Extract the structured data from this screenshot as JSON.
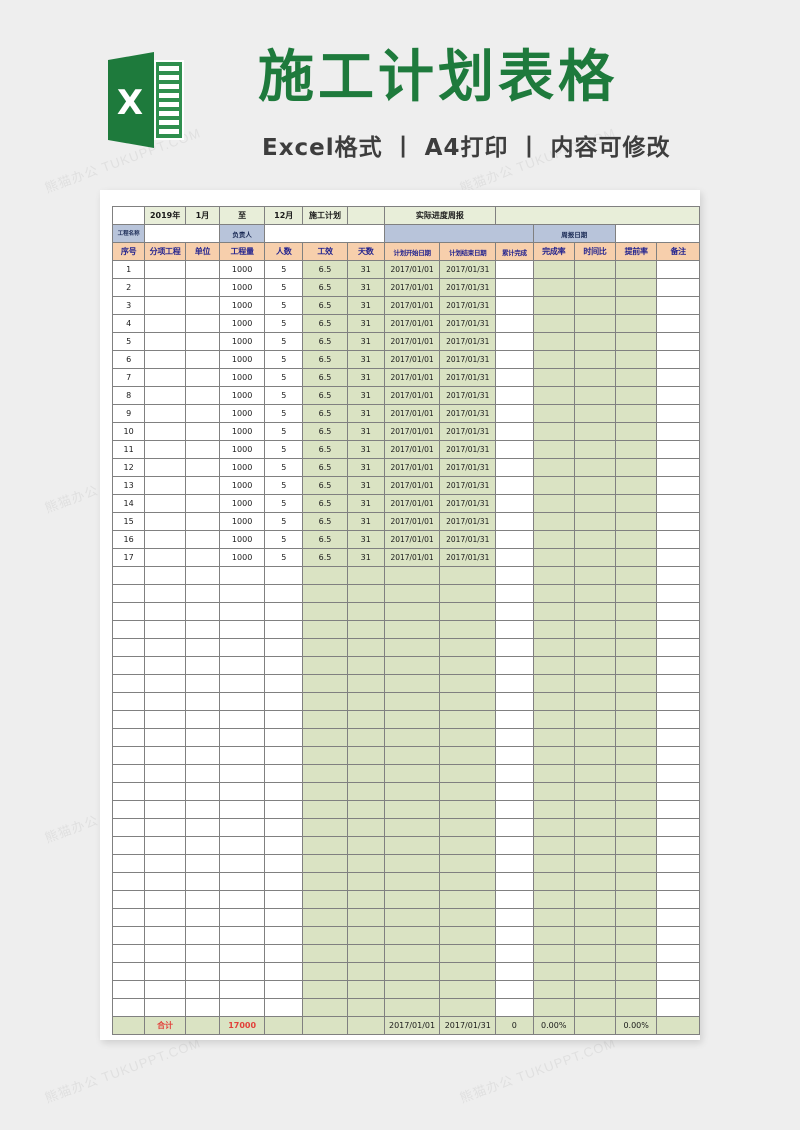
{
  "banner": {
    "title": "施工计划表格",
    "subtitle": "Excel格式 丨 A4打印 丨 内容可修改",
    "logo_letter": "X",
    "brand_color": "#1e7a3c"
  },
  "watermarks": [
    "熊猫办公 TUKUPPT.COM",
    "熊猫办公 TUKUPPT.COM",
    "熊猫办公 TUKUPPT.COM",
    "熊猫办公 TUKUPPT.COM",
    "熊猫办公 TUKUPPT.COM",
    "熊猫办公 TUKUPPT.COM",
    "熊猫办公 TUKUPPT.COM",
    "熊猫办公 TUKUPPT.COM",
    "熊猫办公 TUKUPPT.COM",
    "熊猫办公 TUKUPPT.COM"
  ],
  "sheet": {
    "title_strip": {
      "year": "2019年",
      "start_month": "1月",
      "to": "至",
      "end_month": "12月",
      "plan_label": "施工计划",
      "progress_label": "实际进度周报"
    },
    "group_headers": {
      "project_name": "工程名称",
      "owner": "负责人",
      "weekly_date": "周报日期"
    },
    "columns": [
      "序号",
      "分项工程",
      "单位",
      "工程量",
      "人数",
      "工效",
      "天数",
      "计划开始日期",
      "计划结束日期",
      "累计完成",
      "完成率",
      "时间比",
      "提前率",
      "备注"
    ],
    "rows": [
      {
        "no": "1",
        "sub": "",
        "unit": "",
        "qty": "1000",
        "people": "5",
        "eff": "6.5",
        "days": "31",
        "start": "2017/01/01",
        "end": "2017/01/31",
        "done": "",
        "rate": "",
        "timeratio": "",
        "ahead": "",
        "remark": ""
      },
      {
        "no": "2",
        "sub": "",
        "unit": "",
        "qty": "1000",
        "people": "5",
        "eff": "6.5",
        "days": "31",
        "start": "2017/01/01",
        "end": "2017/01/31",
        "done": "",
        "rate": "",
        "timeratio": "",
        "ahead": "",
        "remark": ""
      },
      {
        "no": "3",
        "sub": "",
        "unit": "",
        "qty": "1000",
        "people": "5",
        "eff": "6.5",
        "days": "31",
        "start": "2017/01/01",
        "end": "2017/01/31",
        "done": "",
        "rate": "",
        "timeratio": "",
        "ahead": "",
        "remark": ""
      },
      {
        "no": "4",
        "sub": "",
        "unit": "",
        "qty": "1000",
        "people": "5",
        "eff": "6.5",
        "days": "31",
        "start": "2017/01/01",
        "end": "2017/01/31",
        "done": "",
        "rate": "",
        "timeratio": "",
        "ahead": "",
        "remark": ""
      },
      {
        "no": "5",
        "sub": "",
        "unit": "",
        "qty": "1000",
        "people": "5",
        "eff": "6.5",
        "days": "31",
        "start": "2017/01/01",
        "end": "2017/01/31",
        "done": "",
        "rate": "",
        "timeratio": "",
        "ahead": "",
        "remark": ""
      },
      {
        "no": "6",
        "sub": "",
        "unit": "",
        "qty": "1000",
        "people": "5",
        "eff": "6.5",
        "days": "31",
        "start": "2017/01/01",
        "end": "2017/01/31",
        "done": "",
        "rate": "",
        "timeratio": "",
        "ahead": "",
        "remark": ""
      },
      {
        "no": "7",
        "sub": "",
        "unit": "",
        "qty": "1000",
        "people": "5",
        "eff": "6.5",
        "days": "31",
        "start": "2017/01/01",
        "end": "2017/01/31",
        "done": "",
        "rate": "",
        "timeratio": "",
        "ahead": "",
        "remark": ""
      },
      {
        "no": "8",
        "sub": "",
        "unit": "",
        "qty": "1000",
        "people": "5",
        "eff": "6.5",
        "days": "31",
        "start": "2017/01/01",
        "end": "2017/01/31",
        "done": "",
        "rate": "",
        "timeratio": "",
        "ahead": "",
        "remark": ""
      },
      {
        "no": "9",
        "sub": "",
        "unit": "",
        "qty": "1000",
        "people": "5",
        "eff": "6.5",
        "days": "31",
        "start": "2017/01/01",
        "end": "2017/01/31",
        "done": "",
        "rate": "",
        "timeratio": "",
        "ahead": "",
        "remark": ""
      },
      {
        "no": "10",
        "sub": "",
        "unit": "",
        "qty": "1000",
        "people": "5",
        "eff": "6.5",
        "days": "31",
        "start": "2017/01/01",
        "end": "2017/01/31",
        "done": "",
        "rate": "",
        "timeratio": "",
        "ahead": "",
        "remark": ""
      },
      {
        "no": "11",
        "sub": "",
        "unit": "",
        "qty": "1000",
        "people": "5",
        "eff": "6.5",
        "days": "31",
        "start": "2017/01/01",
        "end": "2017/01/31",
        "done": "",
        "rate": "",
        "timeratio": "",
        "ahead": "",
        "remark": ""
      },
      {
        "no": "12",
        "sub": "",
        "unit": "",
        "qty": "1000",
        "people": "5",
        "eff": "6.5",
        "days": "31",
        "start": "2017/01/01",
        "end": "2017/01/31",
        "done": "",
        "rate": "",
        "timeratio": "",
        "ahead": "",
        "remark": ""
      },
      {
        "no": "13",
        "sub": "",
        "unit": "",
        "qty": "1000",
        "people": "5",
        "eff": "6.5",
        "days": "31",
        "start": "2017/01/01",
        "end": "2017/01/31",
        "done": "",
        "rate": "",
        "timeratio": "",
        "ahead": "",
        "remark": ""
      },
      {
        "no": "14",
        "sub": "",
        "unit": "",
        "qty": "1000",
        "people": "5",
        "eff": "6.5",
        "days": "31",
        "start": "2017/01/01",
        "end": "2017/01/31",
        "done": "",
        "rate": "",
        "timeratio": "",
        "ahead": "",
        "remark": ""
      },
      {
        "no": "15",
        "sub": "",
        "unit": "",
        "qty": "1000",
        "people": "5",
        "eff": "6.5",
        "days": "31",
        "start": "2017/01/01",
        "end": "2017/01/31",
        "done": "",
        "rate": "",
        "timeratio": "",
        "ahead": "",
        "remark": ""
      },
      {
        "no": "16",
        "sub": "",
        "unit": "",
        "qty": "1000",
        "people": "5",
        "eff": "6.5",
        "days": "31",
        "start": "2017/01/01",
        "end": "2017/01/31",
        "done": "",
        "rate": "",
        "timeratio": "",
        "ahead": "",
        "remark": ""
      },
      {
        "no": "17",
        "sub": "",
        "unit": "",
        "qty": "1000",
        "people": "5",
        "eff": "6.5",
        "days": "31",
        "start": "2017/01/01",
        "end": "2017/01/31",
        "done": "",
        "rate": "",
        "timeratio": "",
        "ahead": "",
        "remark": ""
      }
    ],
    "empty_row_count": 25,
    "total_row": {
      "no": "",
      "sub": "合计",
      "unit": "",
      "qty": "17000",
      "people": "",
      "eff": "",
      "days": "",
      "start": "2017/01/01",
      "end": "2017/01/31",
      "done": "0",
      "rate": "0.00%",
      "timeratio": "",
      "ahead": "0.00%",
      "remark": ""
    }
  }
}
